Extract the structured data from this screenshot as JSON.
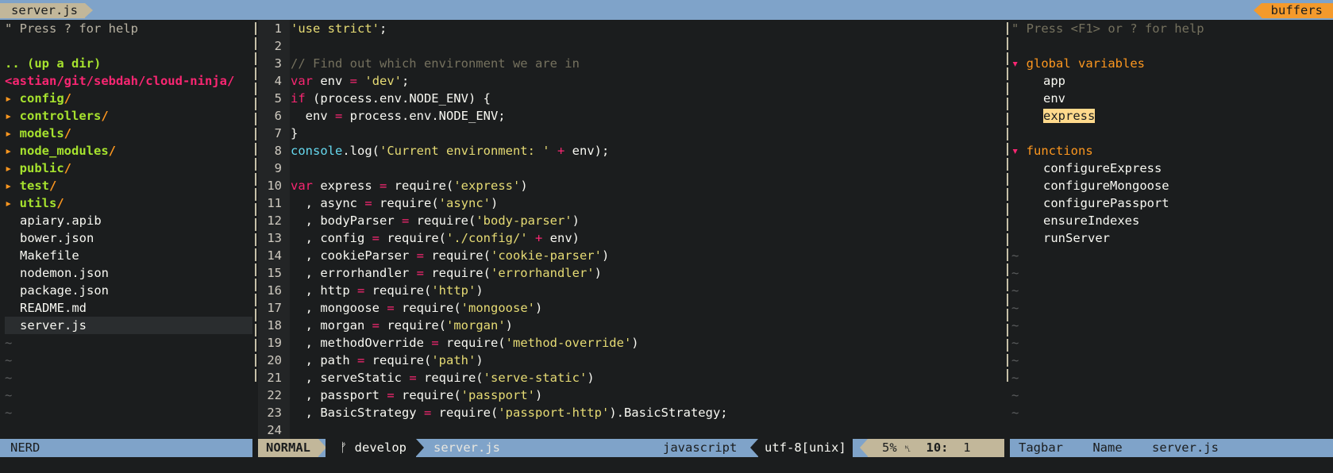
{
  "tabline": {
    "current_tab": "server.js",
    "buffers_label": "buffers"
  },
  "nerdtree": {
    "help": "\" Press ? for help",
    "up_dir": ".. (up a dir)",
    "root": "<astian/git/sebdah/cloud-ninja/",
    "dirs": [
      "config",
      "controllers",
      "models",
      "node_modules",
      "public",
      "test",
      "utils"
    ],
    "files": [
      "apiary.apib",
      "bower.json",
      "Makefile",
      "nodemon.json",
      "package.json",
      "README.md",
      "server.js"
    ],
    "selected_file": "server.js",
    "status": "NERD"
  },
  "editor": {
    "lines": [
      [
        {
          "t": "'use strict'",
          "c": "str"
        },
        {
          "t": ";",
          "c": ""
        }
      ],
      [],
      [
        {
          "t": "// Find out which environment we are in",
          "c": "cm"
        }
      ],
      [
        {
          "t": "var",
          "c": "kw"
        },
        {
          "t": " env ",
          "c": ""
        },
        {
          "t": "=",
          "c": "op"
        },
        {
          "t": " ",
          "c": ""
        },
        {
          "t": "'dev'",
          "c": "str"
        },
        {
          "t": ";",
          "c": ""
        }
      ],
      [
        {
          "t": "if",
          "c": "kw"
        },
        {
          "t": " (process.env.NODE_ENV) {",
          "c": ""
        }
      ],
      [
        {
          "t": "  env ",
          "c": ""
        },
        {
          "t": "=",
          "c": "op"
        },
        {
          "t": " process.env.NODE_ENV;",
          "c": ""
        }
      ],
      [
        {
          "t": "}",
          "c": ""
        }
      ],
      [
        {
          "t": "console",
          "c": "bi"
        },
        {
          "t": ".log(",
          "c": ""
        },
        {
          "t": "'Current environment: '",
          "c": "str"
        },
        {
          "t": " ",
          "c": ""
        },
        {
          "t": "+",
          "c": "op"
        },
        {
          "t": " env);",
          "c": ""
        }
      ],
      [],
      [
        {
          "t": "var",
          "c": "kw"
        },
        {
          "t": " express ",
          "c": ""
        },
        {
          "t": "=",
          "c": "op"
        },
        {
          "t": " require(",
          "c": ""
        },
        {
          "t": "'express'",
          "c": "str"
        },
        {
          "t": ")",
          "c": ""
        }
      ],
      [
        {
          "t": "  , async ",
          "c": ""
        },
        {
          "t": "=",
          "c": "op"
        },
        {
          "t": " require(",
          "c": ""
        },
        {
          "t": "'async'",
          "c": "str"
        },
        {
          "t": ")",
          "c": ""
        }
      ],
      [
        {
          "t": "  , bodyParser ",
          "c": ""
        },
        {
          "t": "=",
          "c": "op"
        },
        {
          "t": " require(",
          "c": ""
        },
        {
          "t": "'body-parser'",
          "c": "str"
        },
        {
          "t": ")",
          "c": ""
        }
      ],
      [
        {
          "t": "  , config ",
          "c": ""
        },
        {
          "t": "=",
          "c": "op"
        },
        {
          "t": " require(",
          "c": ""
        },
        {
          "t": "'./config/'",
          "c": "str"
        },
        {
          "t": " ",
          "c": ""
        },
        {
          "t": "+",
          "c": "op"
        },
        {
          "t": " env)",
          "c": ""
        }
      ],
      [
        {
          "t": "  , cookieParser ",
          "c": ""
        },
        {
          "t": "=",
          "c": "op"
        },
        {
          "t": " require(",
          "c": ""
        },
        {
          "t": "'cookie-parser'",
          "c": "str"
        },
        {
          "t": ")",
          "c": ""
        }
      ],
      [
        {
          "t": "  , errorhandler ",
          "c": ""
        },
        {
          "t": "=",
          "c": "op"
        },
        {
          "t": " require(",
          "c": ""
        },
        {
          "t": "'errorhandler'",
          "c": "str"
        },
        {
          "t": ")",
          "c": ""
        }
      ],
      [
        {
          "t": "  , http ",
          "c": ""
        },
        {
          "t": "=",
          "c": "op"
        },
        {
          "t": " require(",
          "c": ""
        },
        {
          "t": "'http'",
          "c": "str"
        },
        {
          "t": ")",
          "c": ""
        }
      ],
      [
        {
          "t": "  , mongoose ",
          "c": ""
        },
        {
          "t": "=",
          "c": "op"
        },
        {
          "t": " require(",
          "c": ""
        },
        {
          "t": "'mongoose'",
          "c": "str"
        },
        {
          "t": ")",
          "c": ""
        }
      ],
      [
        {
          "t": "  , morgan ",
          "c": ""
        },
        {
          "t": "=",
          "c": "op"
        },
        {
          "t": " require(",
          "c": ""
        },
        {
          "t": "'morgan'",
          "c": "str"
        },
        {
          "t": ")",
          "c": ""
        }
      ],
      [
        {
          "t": "  , methodOverride ",
          "c": ""
        },
        {
          "t": "=",
          "c": "op"
        },
        {
          "t": " require(",
          "c": ""
        },
        {
          "t": "'method-override'",
          "c": "str"
        },
        {
          "t": ")",
          "c": ""
        }
      ],
      [
        {
          "t": "  , path ",
          "c": ""
        },
        {
          "t": "=",
          "c": "op"
        },
        {
          "t": " require(",
          "c": ""
        },
        {
          "t": "'path'",
          "c": "str"
        },
        {
          "t": ")",
          "c": ""
        }
      ],
      [
        {
          "t": "  , serveStatic ",
          "c": ""
        },
        {
          "t": "=",
          "c": "op"
        },
        {
          "t": " require(",
          "c": ""
        },
        {
          "t": "'serve-static'",
          "c": "str"
        },
        {
          "t": ")",
          "c": ""
        }
      ],
      [
        {
          "t": "  , passport ",
          "c": ""
        },
        {
          "t": "=",
          "c": "op"
        },
        {
          "t": " require(",
          "c": ""
        },
        {
          "t": "'passport'",
          "c": "str"
        },
        {
          "t": ")",
          "c": ""
        }
      ],
      [
        {
          "t": "  , BasicStrategy ",
          "c": ""
        },
        {
          "t": "=",
          "c": "op"
        },
        {
          "t": " require(",
          "c": ""
        },
        {
          "t": "'passport-http'",
          "c": "str"
        },
        {
          "t": ").BasicStrategy;",
          "c": ""
        }
      ],
      []
    ]
  },
  "tagbar": {
    "help": "\" Press <F1> or ? for help",
    "groups": [
      {
        "kind": "global variables",
        "items": [
          "app",
          "env",
          "express"
        ]
      },
      {
        "kind": "functions",
        "items": [
          "configureExpress",
          "configureMongoose",
          "configurePassport",
          "ensureIndexes",
          "runServer"
        ]
      }
    ],
    "highlighted_item": "express",
    "status": {
      "plugin": "Tagbar",
      "sort": "Name",
      "file": "server.js"
    }
  },
  "statusline": {
    "mode": "NORMAL",
    "branch_icon": "ᚠ",
    "branch": "develop",
    "filename": "server.js",
    "filetype": "javascript",
    "encoding": "utf-8[unix]",
    "percent": "5%",
    "ln_icon": "␤",
    "line": "10",
    "col": "1"
  },
  "colors": {
    "background": "#1b1d1e",
    "statusline": "#7fa3c9",
    "mode": "#c2b79a",
    "keyword": "#f92672",
    "string": "#e6db74",
    "comment": "#75715e",
    "directory": "#a6e22e",
    "accent": "#fd971f"
  }
}
